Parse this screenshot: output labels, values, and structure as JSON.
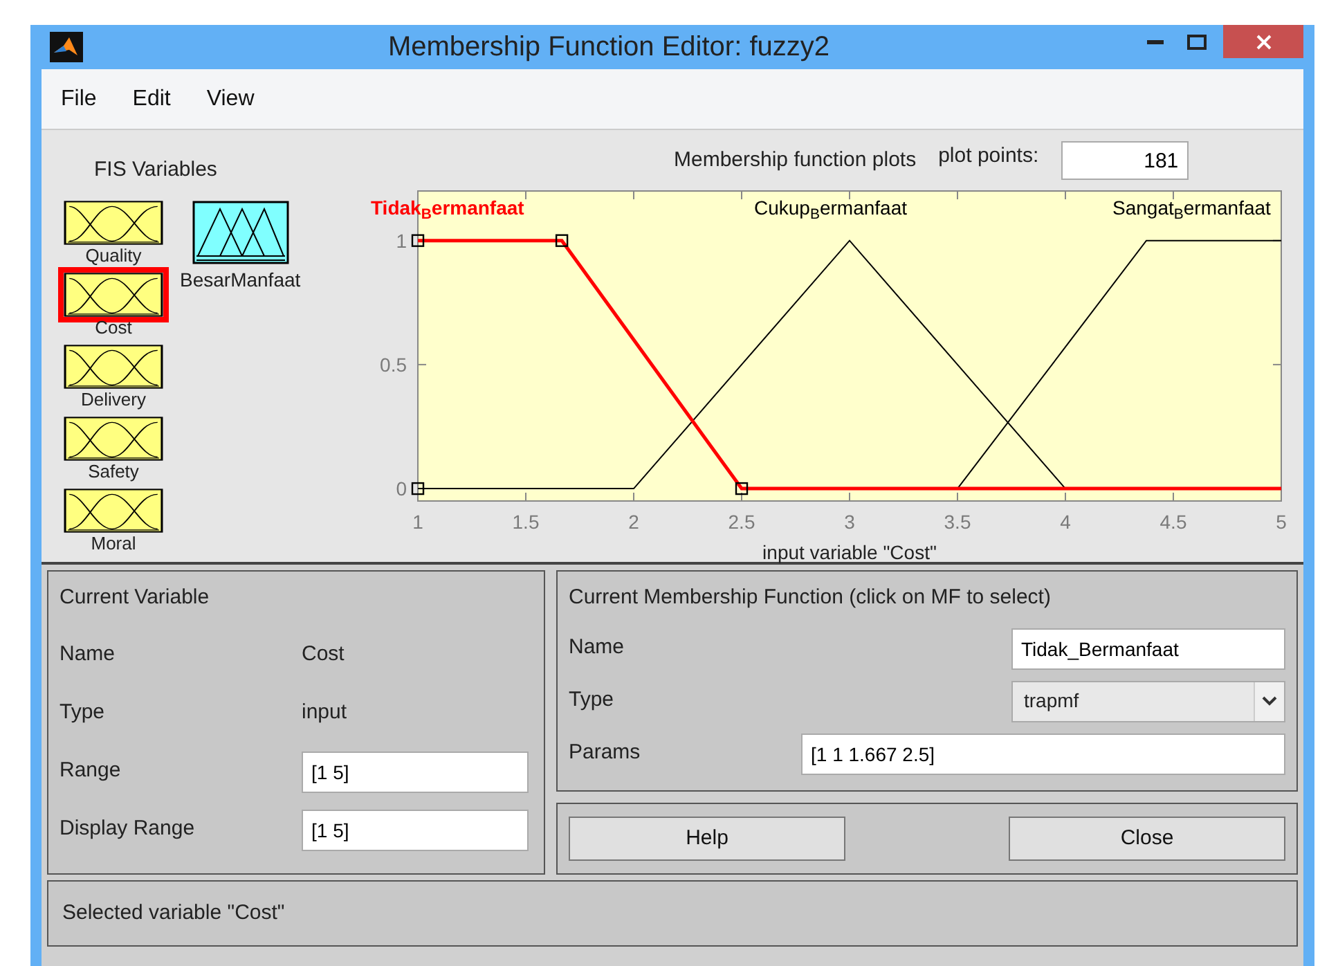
{
  "window": {
    "title": "Membership Function Editor: fuzzy2"
  },
  "menu": [
    "File",
    "Edit",
    "View"
  ],
  "fis_variables": {
    "title": "FIS Variables",
    "inputs": [
      {
        "name": "Quality",
        "selected": false
      },
      {
        "name": "Cost",
        "selected": true
      },
      {
        "name": "Delivery",
        "selected": false
      },
      {
        "name": "Safety",
        "selected": false
      },
      {
        "name": "Moral",
        "selected": false
      }
    ],
    "outputs": [
      {
        "name": "BesarManfaat",
        "selected": false
      }
    ]
  },
  "plot": {
    "title": "Membership function plots",
    "plot_points_label": "plot points:",
    "plot_points": "181",
    "mf_states": [
      {
        "selected": true
      },
      {
        "selected": false
      },
      {
        "selected": false
      }
    ],
    "chart_data": {
      "type": "line",
      "xlabel": "input variable \"Cost\"",
      "x": [
        1,
        1.667,
        2,
        2.5,
        3,
        3.5,
        4,
        4.375,
        5
      ],
      "series": [
        {
          "name": "Tidak$_{B}$ermanfaat",
          "color": "#ff0000",
          "values": [
            1,
            1,
            0.6,
            0,
            0,
            0,
            0,
            0,
            0
          ]
        },
        {
          "name": "Cukup$_{B}$ermanfaat",
          "color": "#000000",
          "values": [
            0,
            0,
            0,
            0.5,
            1,
            0.5,
            0,
            null,
            null
          ]
        },
        {
          "name": "Sangat$_{B}$ermanfaat",
          "color": "#000000",
          "values": [
            null,
            null,
            null,
            null,
            null,
            0,
            0.571,
            1,
            1
          ]
        }
      ],
      "xlim": [
        1,
        5
      ],
      "ylim": [
        -0.05,
        1.2
      ],
      "xticks": [
        1,
        1.5,
        2,
        2.5,
        3,
        3.5,
        4,
        4.5,
        5
      ],
      "yticks": [
        0,
        0.5,
        1
      ]
    }
  },
  "current_variable": {
    "title": "Current Variable",
    "fields": [
      {
        "label": "Name",
        "value": "Cost",
        "kind": "text"
      },
      {
        "label": "Type",
        "value": "input",
        "kind": "text"
      },
      {
        "label": "Range",
        "value": "[1 5]",
        "kind": "input"
      },
      {
        "label": "Display Range",
        "value": "[1 5]",
        "kind": "input"
      }
    ]
  },
  "current_mf": {
    "title": "Current Membership Function (click on MF to select)",
    "fields": [
      {
        "label": "Name",
        "value": "Tidak_Bermanfaat",
        "kind": "input"
      },
      {
        "label": "Type",
        "value": "trapmf",
        "kind": "select"
      },
      {
        "label": "Params",
        "value": "[1 1 1.667 2.5]",
        "kind": "wide-input"
      }
    ]
  },
  "buttons": [
    "Help",
    "Close"
  ],
  "status": "Selected variable \"Cost\""
}
